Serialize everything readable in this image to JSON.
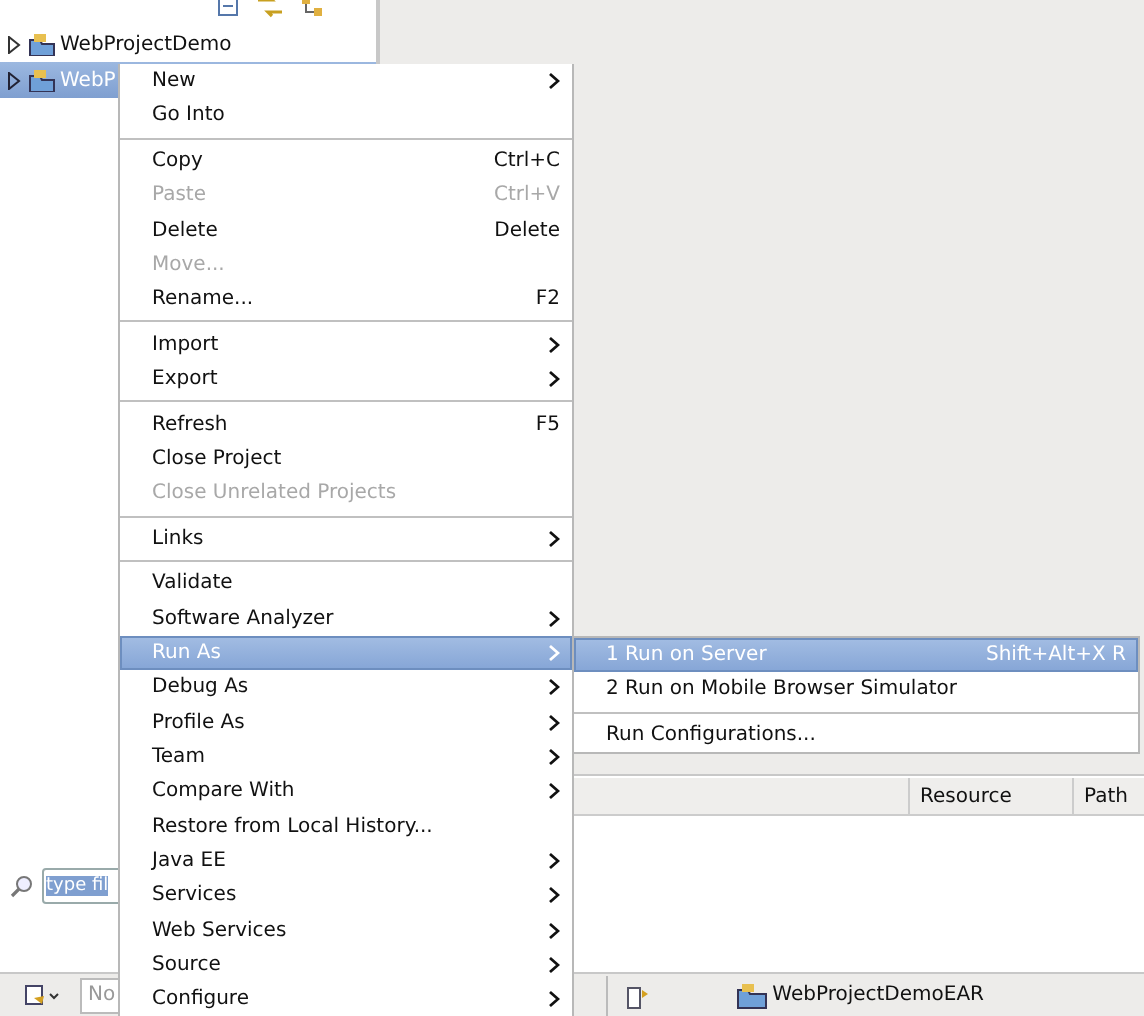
{
  "explorer": {
    "tree": [
      {
        "label": "WebProjectDemo",
        "selected": false,
        "expanded": false
      },
      {
        "label": "WebP",
        "selected": true,
        "expanded": false
      }
    ],
    "filter": {
      "value": "type fil",
      "text_selected": true
    }
  },
  "bottom_toolbar": {
    "field": {
      "placeholder": "No"
    }
  },
  "context_menu": {
    "items": [
      {
        "kind": "item",
        "label": "New",
        "submenu": true,
        "disabled": false,
        "selected": false
      },
      {
        "kind": "item",
        "label": "Go Into",
        "submenu": false,
        "disabled": false,
        "selected": false
      },
      {
        "kind": "separator"
      },
      {
        "kind": "item",
        "label": "Copy",
        "shortcut": "Ctrl+C",
        "submenu": false,
        "disabled": false,
        "selected": false
      },
      {
        "kind": "item",
        "label": "Paste",
        "shortcut": "Ctrl+V",
        "submenu": false,
        "disabled": true,
        "selected": false
      },
      {
        "kind": "item",
        "label": "Delete",
        "shortcut": "Delete",
        "submenu": false,
        "disabled": false,
        "selected": false
      },
      {
        "kind": "item",
        "label": "Move...",
        "submenu": false,
        "disabled": true,
        "selected": false
      },
      {
        "kind": "item",
        "label": "Rename...",
        "shortcut": "F2",
        "submenu": false,
        "disabled": false,
        "selected": false
      },
      {
        "kind": "separator"
      },
      {
        "kind": "item",
        "label": "Import",
        "submenu": true,
        "disabled": false,
        "selected": false
      },
      {
        "kind": "item",
        "label": "Export",
        "submenu": true,
        "disabled": false,
        "selected": false
      },
      {
        "kind": "separator"
      },
      {
        "kind": "item",
        "label": "Refresh",
        "shortcut": "F5",
        "submenu": false,
        "disabled": false,
        "selected": false
      },
      {
        "kind": "item",
        "label": "Close Project",
        "submenu": false,
        "disabled": false,
        "selected": false
      },
      {
        "kind": "item",
        "label": "Close Unrelated Projects",
        "submenu": false,
        "disabled": true,
        "selected": false
      },
      {
        "kind": "separator"
      },
      {
        "kind": "item",
        "label": "Links",
        "submenu": true,
        "disabled": false,
        "selected": false
      },
      {
        "kind": "separator"
      },
      {
        "kind": "item",
        "label": "Validate",
        "submenu": false,
        "disabled": false,
        "selected": false
      },
      {
        "kind": "item",
        "label": "Software Analyzer",
        "submenu": true,
        "disabled": false,
        "selected": false
      },
      {
        "kind": "item",
        "label": "Run As",
        "submenu": true,
        "disabled": false,
        "selected": true
      },
      {
        "kind": "item",
        "label": "Debug As",
        "submenu": true,
        "disabled": false,
        "selected": false
      },
      {
        "kind": "item",
        "label": "Profile As",
        "submenu": true,
        "disabled": false,
        "selected": false
      },
      {
        "kind": "item",
        "label": "Team",
        "submenu": true,
        "disabled": false,
        "selected": false
      },
      {
        "kind": "item",
        "label": "Compare With",
        "submenu": true,
        "disabled": false,
        "selected": false
      },
      {
        "kind": "item",
        "label": "Restore from Local History...",
        "submenu": false,
        "disabled": false,
        "selected": false
      },
      {
        "kind": "item",
        "label": "Java EE",
        "submenu": true,
        "disabled": false,
        "selected": false
      },
      {
        "kind": "item",
        "label": "Services",
        "submenu": true,
        "disabled": false,
        "selected": false
      },
      {
        "kind": "item",
        "label": "Web Services",
        "submenu": true,
        "disabled": false,
        "selected": false
      },
      {
        "kind": "item",
        "label": "Source",
        "submenu": true,
        "disabled": false,
        "selected": false
      },
      {
        "kind": "item",
        "label": "Configure",
        "submenu": true,
        "disabled": false,
        "selected": false
      }
    ]
  },
  "run_as_submenu": {
    "items": [
      {
        "kind": "item",
        "label": "1 Run on Server",
        "shortcut": "Shift+Alt+X R",
        "submenu": false,
        "disabled": false,
        "selected": true
      },
      {
        "kind": "item",
        "label": "2 Run on Mobile Browser Simulator",
        "submenu": false,
        "disabled": false,
        "selected": false
      },
      {
        "kind": "separator"
      },
      {
        "kind": "item",
        "label": "Run Configurations...",
        "submenu": false,
        "disabled": false,
        "selected": false
      }
    ]
  },
  "problems_table": {
    "columns": [
      "Resource",
      "Path"
    ]
  },
  "status_bar": {
    "project": "WebProjectDemoEAR"
  }
}
